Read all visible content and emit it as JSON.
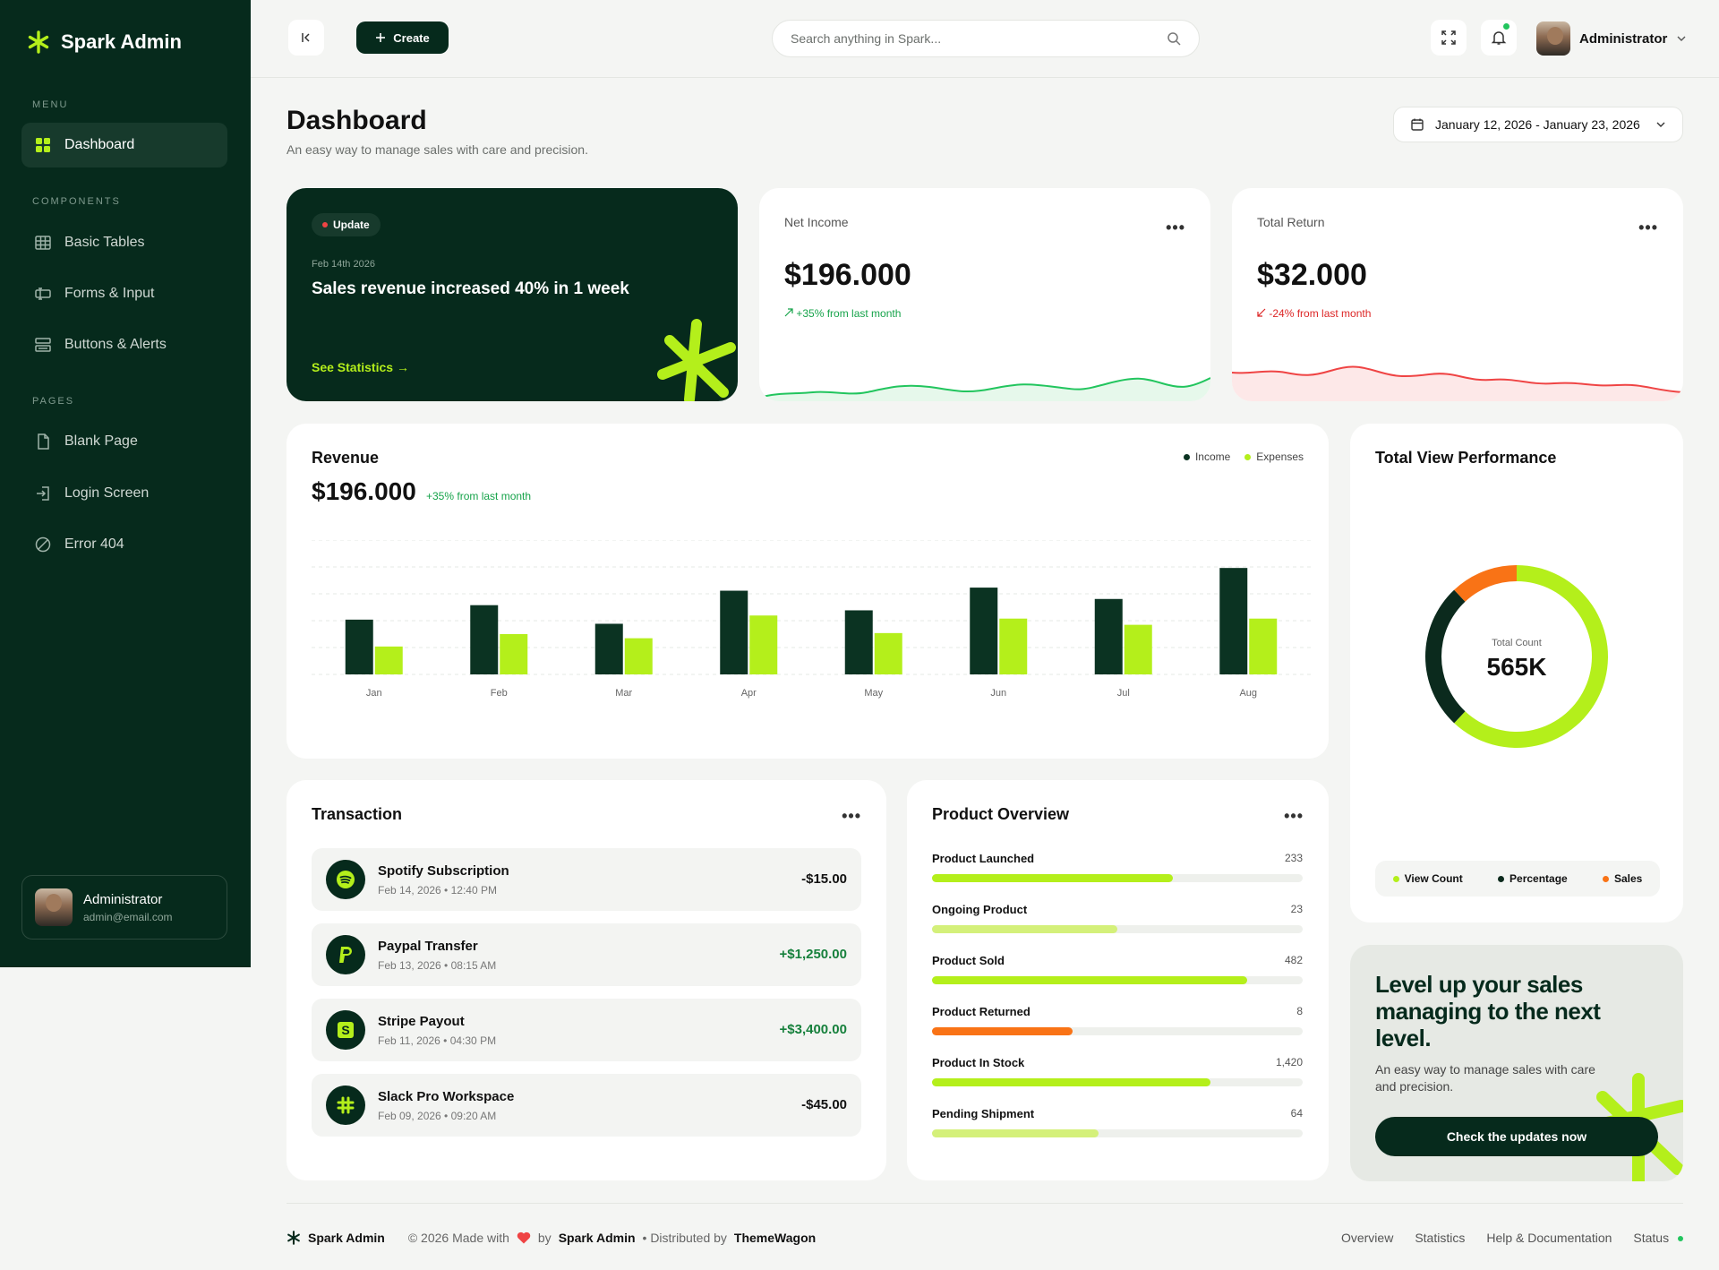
{
  "brand": {
    "name": "Spark Admin"
  },
  "sidebar": {
    "menu_title": "MENU",
    "components_title": "COMPONENTS",
    "pages_title": "PAGES",
    "items": [
      {
        "label": "Dashboard",
        "icon": "grid-icon"
      },
      {
        "label": "Basic Tables",
        "icon": "table-icon"
      },
      {
        "label": "Forms & Input",
        "icon": "form-icon"
      },
      {
        "label": "Buttons & Alerts",
        "icon": "buttons-icon"
      },
      {
        "label": "Blank Page",
        "icon": "file-icon"
      },
      {
        "label": "Login Screen",
        "icon": "login-icon"
      },
      {
        "label": "Error 404",
        "icon": "error-icon"
      }
    ],
    "user": {
      "name": "Administrator",
      "email": "admin@email.com"
    }
  },
  "topbar": {
    "create_label": "Create",
    "search_placeholder": "Search anything in Spark...",
    "user_name": "Administrator"
  },
  "page": {
    "title": "Dashboard",
    "subtitle": "An easy way to manage sales with care and precision.",
    "date_range": "January 12, 2026 - January 23, 2026"
  },
  "update_card": {
    "badge": "Update",
    "date": "Feb 14th 2026",
    "title": "Sales revenue increased 40% in 1 week",
    "link": "See Statistics →"
  },
  "net_income": {
    "label": "Net Income",
    "value": "$196.000",
    "delta": "+35% from last month"
  },
  "total_return": {
    "label": "Total Return",
    "value": "$32.000",
    "delta": "-24% from last month"
  },
  "revenue": {
    "title": "Revenue",
    "value": "$196.000",
    "delta": "+35% from last month"
  },
  "chart_data": {
    "type": "bar",
    "categories": [
      "Jan",
      "Feb",
      "Mar",
      "Apr",
      "May",
      "Jun",
      "Jul",
      "Aug"
    ],
    "series": [
      {
        "name": "Income",
        "values": [
          53,
          67,
          49,
          81,
          62,
          84,
          73,
          103
        ],
        "color": "#0b3322"
      },
      {
        "name": "Expenses",
        "values": [
          27,
          39,
          35,
          57,
          40,
          54,
          48,
          54
        ],
        "color": "#b4ef1b"
      }
    ],
    "ylim": [
      0,
      130
    ]
  },
  "view_performance": {
    "title": "Total View Performance",
    "center_label": "Total Count",
    "center_value": "565K",
    "segments": [
      {
        "name": "View Count",
        "value": 62,
        "color": "#b4ef1b"
      },
      {
        "name": "Percentage",
        "value": 26,
        "color": "#0b2a1d"
      },
      {
        "name": "Sales",
        "value": 12,
        "color": "#f97316"
      }
    ]
  },
  "transactions": {
    "title": "Transaction",
    "items": [
      {
        "name": "Spotify Subscription",
        "date": "Feb 14, 2026 • 12:40 PM",
        "amount": "-$15.00",
        "icon": "spotify-icon",
        "positive": false
      },
      {
        "name": "Paypal Transfer",
        "date": "Feb 13, 2026 • 08:15 AM",
        "amount": "+$1,250.00",
        "icon": "paypal-icon",
        "positive": true
      },
      {
        "name": "Stripe Payout",
        "date": "Feb 11, 2026 • 04:30 PM",
        "amount": "+$3,400.00",
        "icon": "stripe-icon",
        "positive": true
      },
      {
        "name": "Slack Pro Workspace",
        "date": "Feb 09, 2026 • 09:20 AM",
        "amount": "-$45.00",
        "icon": "slack-icon",
        "positive": false
      }
    ]
  },
  "product_overview": {
    "title": "Product Overview",
    "items": [
      {
        "label": "Product Launched",
        "value": "233",
        "fill": 0.65,
        "color": "#b4ef1b"
      },
      {
        "label": "Ongoing Product",
        "value": "23",
        "fill": 0.5,
        "color": "#d4f07a"
      },
      {
        "label": "Product Sold",
        "value": "482",
        "fill": 0.85,
        "color": "#b4ef1b"
      },
      {
        "label": "Product Returned",
        "value": "8",
        "fill": 0.38,
        "color": "#f97316"
      },
      {
        "label": "Product In Stock",
        "value": "1,420",
        "fill": 0.75,
        "color": "#b4ef1b"
      },
      {
        "label": "Pending Shipment",
        "value": "64",
        "fill": 0.45,
        "color": "#d4f07a"
      }
    ]
  },
  "promo": {
    "title": "Level up your sales managing to the next level.",
    "subtitle": "An easy way to manage sales with care and precision.",
    "button": "Check the updates now"
  },
  "footer": {
    "brand": "Spark Admin",
    "copyright": "© 2026 Made with",
    "by": "by",
    "by_name": "Spark Admin",
    "distributed": "• Distributed by",
    "distributor": "ThemeWagon",
    "links": [
      "Overview",
      "Statistics",
      "Help & Documentation",
      "Status"
    ]
  },
  "colors": {
    "primary": "#062a1c",
    "accent": "#b4ef1b",
    "positive": "#16a34a",
    "negative": "#dc2626",
    "orange": "#f97316"
  }
}
